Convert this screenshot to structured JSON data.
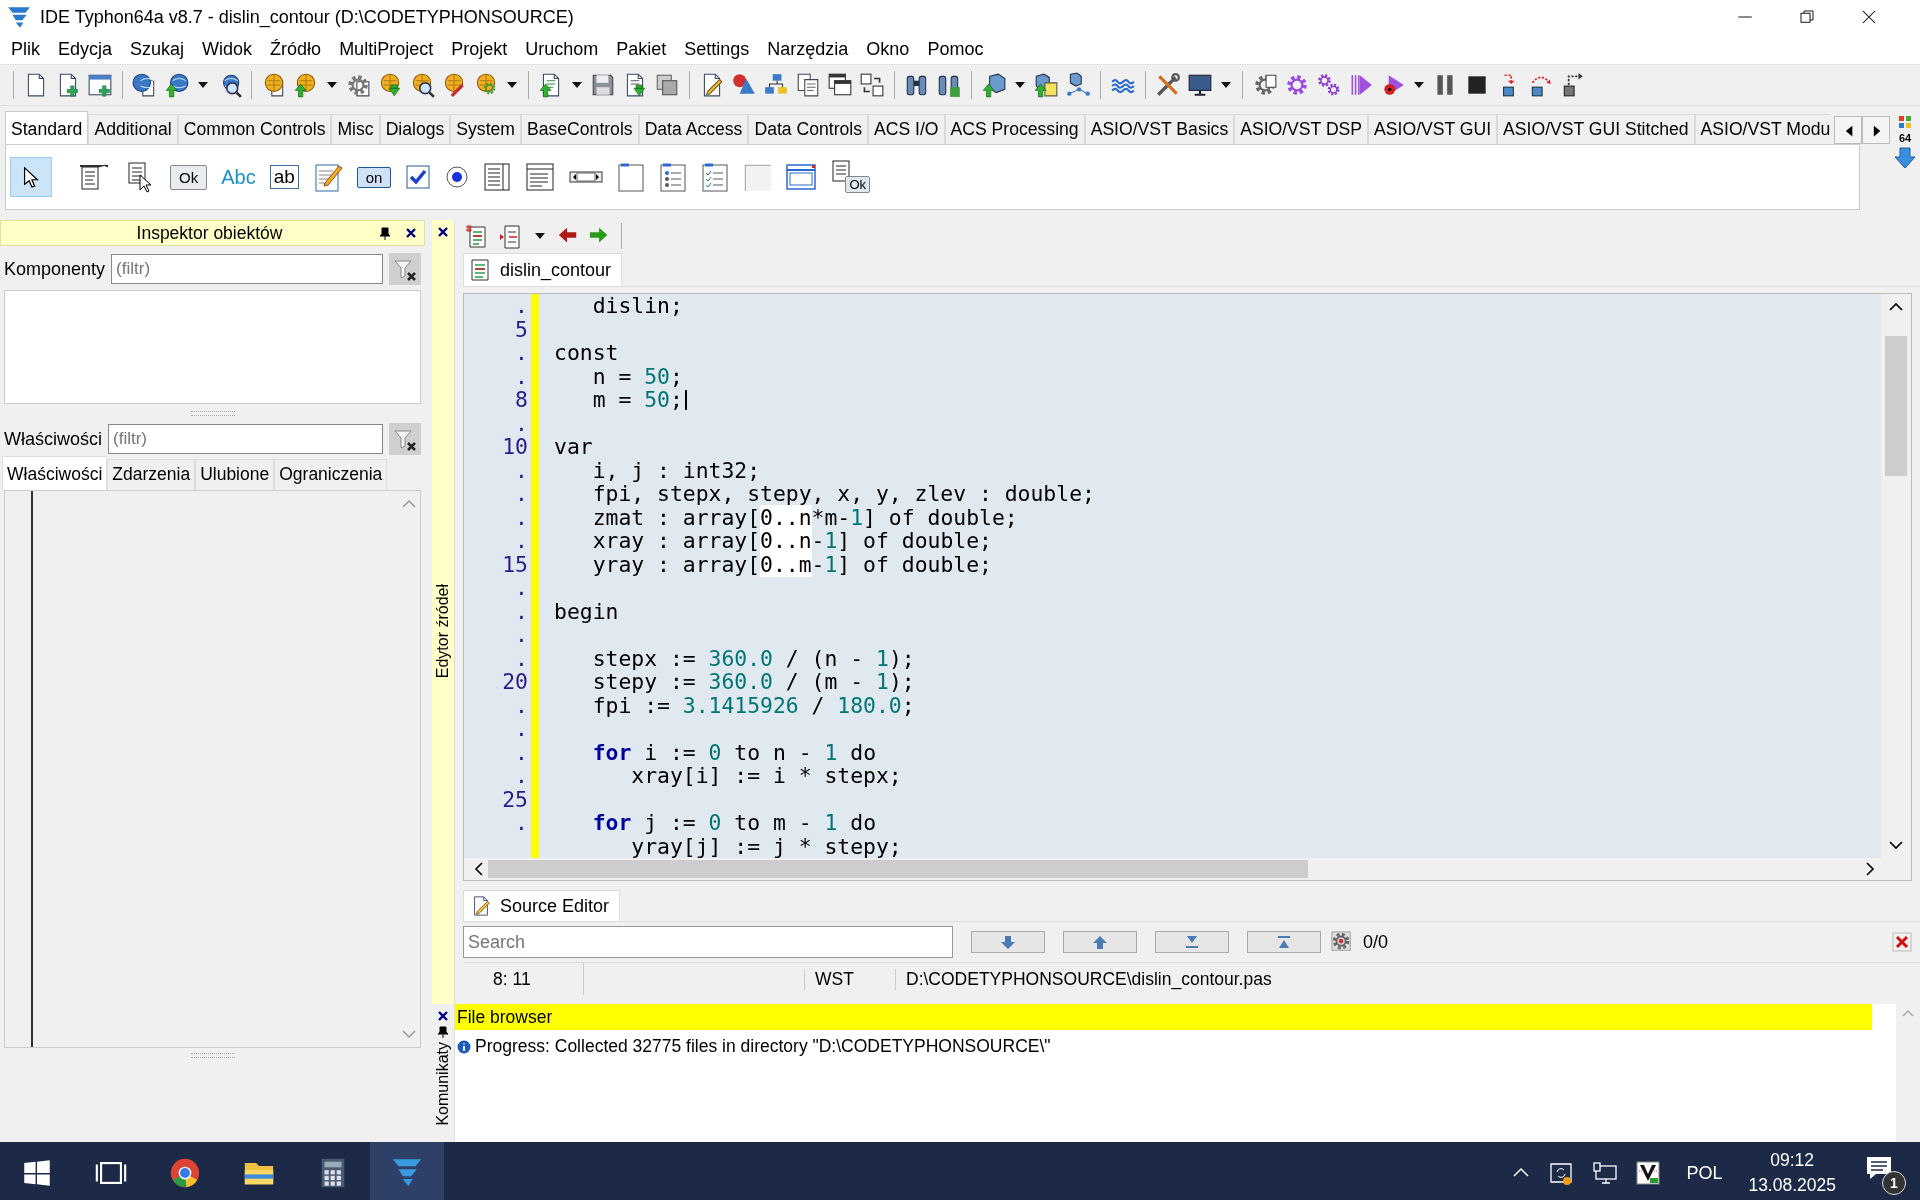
{
  "window": {
    "title": "IDE Typhon64a v8.7 - dislin_contour (D:\\CODETYPHONSOURCE)"
  },
  "menu": [
    "Plik",
    "Edycja",
    "Szukaj",
    "Widok",
    "Źródło",
    "MultiProject",
    "Projekt",
    "Uruchom",
    "Pakiet",
    "Settings",
    "Narzędzia",
    "Okno",
    "Pomoc"
  ],
  "palette": {
    "tabs": [
      {
        "label": "Standard",
        "selected": true
      },
      {
        "label": "Additional",
        "selected": false
      },
      {
        "label": "Common Controls",
        "selected": false
      },
      {
        "label": "Misc",
        "selected": false
      },
      {
        "label": "Dialogs",
        "selected": false
      },
      {
        "label": "System",
        "selected": false
      },
      {
        "label": "BaseControls",
        "selected": false
      },
      {
        "label": "Data Access",
        "selected": false
      },
      {
        "label": "Data Controls",
        "selected": false
      },
      {
        "label": "ACS I/O",
        "selected": false
      },
      {
        "label": "ACS Processing",
        "selected": false
      },
      {
        "label": "ASIO/VST Basics",
        "selected": false
      },
      {
        "label": "ASIO/VST DSP",
        "selected": false
      },
      {
        "label": "ASIO/VST GUI",
        "selected": false
      },
      {
        "label": "ASIO/VST GUI Stitched",
        "selected": false
      },
      {
        "label": "ASIO/VST Modu",
        "selected": false
      }
    ],
    "components": [
      {
        "kind": "pointer",
        "selected": true
      },
      {
        "kind": "main-menu",
        "selected": false
      },
      {
        "kind": "popup-menu",
        "selected": false
      },
      {
        "kind": "button",
        "label": "Ok",
        "selected": false
      },
      {
        "kind": "label",
        "label": "Abc",
        "selected": false
      },
      {
        "kind": "edit",
        "label": "ab",
        "selected": false
      },
      {
        "kind": "memo",
        "selected": false
      },
      {
        "kind": "toggle",
        "label": "on",
        "selected": false
      },
      {
        "kind": "checkbox",
        "selected": false
      },
      {
        "kind": "radio",
        "selected": false
      },
      {
        "kind": "listbox",
        "selected": false
      },
      {
        "kind": "combobox",
        "selected": false
      },
      {
        "kind": "scrollbar",
        "selected": false
      },
      {
        "kind": "groupbox",
        "selected": false
      },
      {
        "kind": "radiogroup",
        "selected": false
      },
      {
        "kind": "checkgroup",
        "selected": false
      },
      {
        "kind": "panel",
        "selected": false
      },
      {
        "kind": "frame",
        "selected": false
      },
      {
        "kind": "actionlist",
        "label": "Ok",
        "selected": false
      }
    ],
    "badge": "64"
  },
  "inspector": {
    "title": "Inspektor obiektów",
    "components_label": "Komponenty",
    "components_filter": {
      "placeholder": "(filtr)"
    },
    "properties_label": "Właściwości",
    "properties_filter": {
      "placeholder": "(filtr)"
    },
    "tabs": [
      {
        "label": "Właściwości",
        "selected": true
      },
      {
        "label": "Zdarzenia",
        "selected": false
      },
      {
        "label": "Ulubione",
        "selected": false
      },
      {
        "label": "Ograniczenia",
        "selected": false
      }
    ]
  },
  "editor": {
    "side_label": "Edytor źródeł",
    "file_tab": "dislin_contour",
    "lines": [
      {
        "gutter": ".",
        "caret": false,
        "segments": [
          {
            "kind": "text",
            "text": "   dislin;"
          }
        ]
      },
      {
        "gutter": "5",
        "caret": false
      },
      {
        "gutter": ".",
        "caret": false,
        "segments": [
          {
            "kind": "text",
            "text": "const"
          }
        ]
      },
      {
        "gutter": ".",
        "caret": false,
        "segments": [
          {
            "kind": "text",
            "text": "   n = "
          },
          {
            "kind": "number",
            "text": "50"
          },
          {
            "kind": "text",
            "text": ";"
          }
        ]
      },
      {
        "gutter": "8",
        "caret": true,
        "segments": [
          {
            "kind": "text",
            "text": "   m = "
          },
          {
            "kind": "number",
            "text": "50"
          },
          {
            "kind": "text",
            "text": ";"
          }
        ]
      },
      {
        "gutter": ".",
        "caret": false
      },
      {
        "gutter": "10",
        "caret": false,
        "segments": [
          {
            "kind": "text",
            "text": "var"
          }
        ]
      },
      {
        "gutter": ".",
        "caret": false,
        "segments": [
          {
            "kind": "text",
            "text": "   i, j : int32;"
          }
        ]
      },
      {
        "gutter": ".",
        "caret": false,
        "segments": [
          {
            "kind": "text",
            "text": "   fpi, stepx, stepy, x, y, zlev : double;"
          }
        ]
      },
      {
        "gutter": ".",
        "caret": false,
        "segments": [
          {
            "kind": "text",
            "text": "   zmat : array["
          },
          {
            "kind": "match",
            "text": "0..n"
          },
          {
            "kind": "text",
            "text": "*m-"
          },
          {
            "kind": "number",
            "text": "1"
          },
          {
            "kind": "text",
            "text": "] of double;"
          }
        ]
      },
      {
        "gutter": ".",
        "caret": false,
        "segments": [
          {
            "kind": "text",
            "text": "   xray : array["
          },
          {
            "kind": "match",
            "text": "0..n"
          },
          {
            "kind": "text",
            "text": "-"
          },
          {
            "kind": "number",
            "text": "1"
          },
          {
            "kind": "text",
            "text": "] of double;"
          }
        ]
      },
      {
        "gutter": "15",
        "caret": false,
        "segments": [
          {
            "kind": "text",
            "text": "   yray : array["
          },
          {
            "kind": "match",
            "text": "0..m"
          },
          {
            "kind": "text",
            "text": "-"
          },
          {
            "kind": "number",
            "text": "1"
          },
          {
            "kind": "text",
            "text": "] of double;"
          }
        ]
      },
      {
        "gutter": ".",
        "caret": false
      },
      {
        "gutter": ".",
        "caret": false,
        "segments": [
          {
            "kind": "text",
            "text": "begin"
          }
        ]
      },
      {
        "gutter": ".",
        "caret": false
      },
      {
        "gutter": ".",
        "caret": false,
        "segments": [
          {
            "kind": "text",
            "text": "   stepx := "
          },
          {
            "kind": "number",
            "text": "360.0"
          },
          {
            "kind": "text",
            "text": " / (n - "
          },
          {
            "kind": "number",
            "text": "1"
          },
          {
            "kind": "text",
            "text": ");"
          }
        ]
      },
      {
        "gutter": "20",
        "caret": false,
        "segments": [
          {
            "kind": "text",
            "text": "   stepy := "
          },
          {
            "kind": "number",
            "text": "360.0"
          },
          {
            "kind": "text",
            "text": " / (m - "
          },
          {
            "kind": "number",
            "text": "1"
          },
          {
            "kind": "text",
            "text": ");"
          }
        ]
      },
      {
        "gutter": ".",
        "caret": false,
        "segments": [
          {
            "kind": "text",
            "text": "   fpi := "
          },
          {
            "kind": "number",
            "text": "3.1415926"
          },
          {
            "kind": "text",
            "text": " / "
          },
          {
            "kind": "number",
            "text": "180.0"
          },
          {
            "kind": "text",
            "text": ";"
          }
        ]
      },
      {
        "gutter": ".",
        "caret": false
      },
      {
        "gutter": ".",
        "caret": false,
        "segments": [
          {
            "kind": "keyword",
            "text": "   for"
          },
          {
            "kind": "text",
            "text": " i := "
          },
          {
            "kind": "number",
            "text": "0"
          },
          {
            "kind": "text",
            "text": " to n - "
          },
          {
            "kind": "number",
            "text": "1"
          },
          {
            "kind": "text",
            "text": " do"
          }
        ]
      },
      {
        "gutter": ".",
        "caret": false,
        "segments": [
          {
            "kind": "text",
            "text": "      xray[i] := i * stepx;"
          }
        ]
      },
      {
        "gutter": "25",
        "caret": false
      },
      {
        "gutter": ".",
        "caret": false,
        "segments": [
          {
            "kind": "keyword",
            "text": "   for"
          },
          {
            "kind": "text",
            "text": " j := "
          },
          {
            "kind": "number",
            "text": "0"
          },
          {
            "kind": "text",
            "text": " to m - "
          },
          {
            "kind": "number",
            "text": "1"
          },
          {
            "kind": "text",
            "text": " do"
          }
        ]
      },
      {
        "caret": false,
        "segments": [
          {
            "kind": "text",
            "text": "      yray[j] := j * stepy;"
          }
        ]
      }
    ],
    "bottom_tab": "Source Editor",
    "search": {
      "placeholder": "Search"
    },
    "match_count": "0/0",
    "status": {
      "position": "8:  11",
      "mode": "WST",
      "path": "D:\\CODETYPHONSOURCE\\dislin_contour.pas"
    }
  },
  "messages": {
    "side_label": "Komunikaty",
    "title": "File browser",
    "items": [
      "Progress: Collected 32775 files in directory \"D:\\CODETYPHONSOURCE\\\""
    ]
  },
  "taskbar": {
    "language": "POL",
    "time": "09:12",
    "date": "13.08.2025",
    "notifications": "1"
  }
}
